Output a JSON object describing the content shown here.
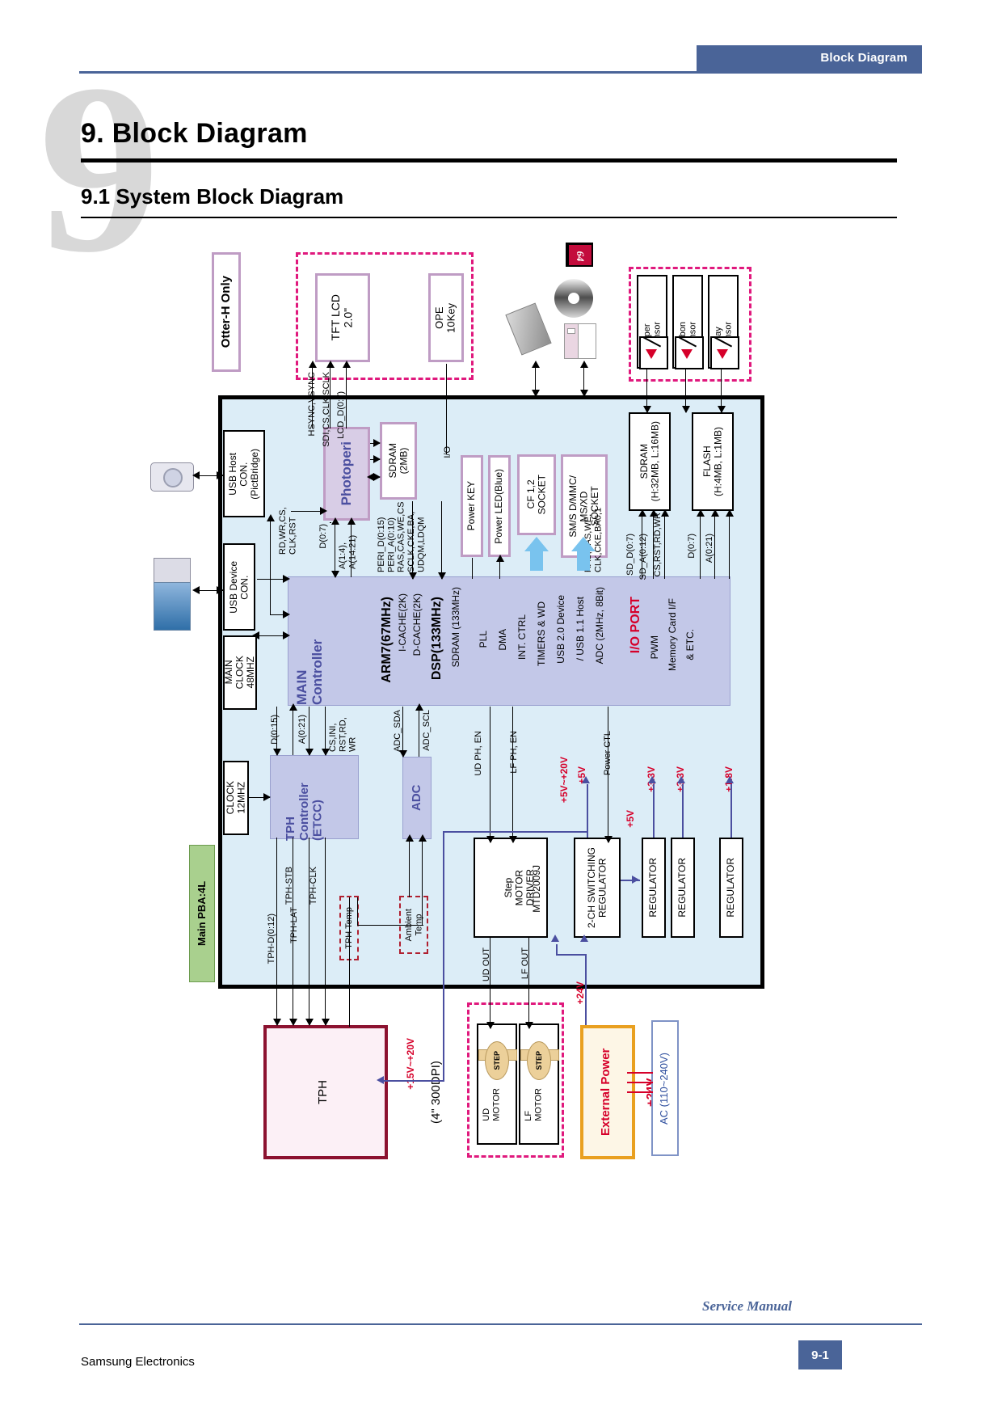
{
  "header": {
    "running_title": "Block Diagram"
  },
  "title": {
    "chapter": "9. Block Diagram",
    "section": "9.1 System Block Diagram",
    "ghost_number": "9"
  },
  "footer": {
    "company": "Samsung Electronics",
    "manual": "Service Manual",
    "page": "9-1"
  },
  "diagram": {
    "otter_note": "Otter-H Only",
    "main_pba": "Main PBA:4L",
    "blocks": {
      "tft_lcd": "TFT LCD\n2.0\"",
      "ope": "OPE\n10Key",
      "usb_host": "USB Host\nCON.\n(PictBridge)",
      "usb_device": "USB Device\nCON.",
      "main_clock": "MAIN\nCLOCK\n48MHZ",
      "clock12": "CLOCK\n12MHZ",
      "photoperi": "Photoperi",
      "sdram2mb": "SDRAM\n(2MB)",
      "power_key": "Power KEY",
      "power_led": "Power LED(Blue)",
      "cf_socket": "CF 1,2\nSOCKET",
      "sm_socket": "SM/S D/MMC/\nMS/XD\nSOCKET",
      "sdram_main": "SDRAM\n(H:32MB, L:16MB)",
      "flash": "FLASH\n(H:4MB, L:1MB)",
      "tph_controller": "TPH\nController\n(ETCC)",
      "adc": "ADC",
      "step_motor_driver": "Step\nMOTOR\nDRIVER",
      "step_motor_part": "MTD2009J",
      "switching_reg": "2-CH SWITCHING\nREGULATOR",
      "regulator": "REGULATOR",
      "tph_head": "TPH\n(4\" 300DPI)",
      "external_power": "External Power\n+24V",
      "ac_input": "AC (110~240V)",
      "ud_motor": "UD\nMOTOR",
      "lf_motor": "LF\nMOTOR",
      "tph_temp": "TPH Temp",
      "ambient_temp": "Ambient\nTemp",
      "cf_card_label": "64"
    },
    "sensors": [
      {
        "name": "Paper\nSensor"
      },
      {
        "name": "Ribbon\nSensor"
      },
      {
        "name": "Tray\nSensor"
      }
    ],
    "main_controller": {
      "title": "MAIN\nController",
      "cpu": "ARM7(67MHz)",
      "cpu_items": [
        "I-CACHE(2K)",
        "D-CACHE(2K)"
      ],
      "dsp": "DSP(133MHz)",
      "dsp_items": [
        "SDRAM (133MHz)",
        "PLL",
        "DMA",
        "INT. CTRL",
        "TIMERS & WD",
        "USB 2.0 Device",
        "/ USB 1.1 Host",
        "ADC (2MHz, 8Bit)"
      ],
      "io_port": "I/O PORT",
      "io_items": [
        "PWM",
        "Memory Card I/F",
        "& ETC."
      ]
    },
    "signals": {
      "hsync": "HSYNC,VSYNC",
      "sdi": "SDI,CS,CLK,SCLK",
      "lcd_d": "LCD_D(0:7)",
      "io": "I/O",
      "rdwr": "RD,WR,CS,\nCLK,RST",
      "d07": "D(0:7)",
      "a14": "A(1:4),\nA(14:21)",
      "peri": "PERI_D(0:15)\nPERI_A(0:10)\nRAS,CAS,WE,CS\nSCLK,CKE,BA,\nUDQM,LDQM",
      "ras": "RAS,CAS,WE,\nCLK,CKE,BA0,1",
      "sd_d": "SD_D(0:7)",
      "sd_a": "SD_A(0:12)",
      "cs_rst": "CS,RST,RD,WR",
      "d07f": "D(0:7)",
      "a021f": "A(0:21)",
      "d015": "D(0:15)",
      "a021": "A(0:21)",
      "cs_ini": "CS,INI,\nRST,RD,\nWR",
      "adc_sda": "ADC_SDA",
      "adc_scl": "ADC_SCL",
      "ud_ph": "UD PH, EN",
      "lf_ph": "LF PH, EN",
      "power_ctl": "Power CTL",
      "ud_out": "UD OUT",
      "lf_out": "LF OUT",
      "tph_d": "TPH-D(0:12)",
      "tph_lat": "TPH-LAT",
      "tph_stb": "TPH-STB",
      "tph_clk": "TPH-CLK"
    },
    "voltages": {
      "v5_20": "+5V~+20V",
      "v5": "+5V",
      "v5b": "+5V",
      "v33a": "+3.3V",
      "v33b": "+3.3V",
      "v18": "+1.8V",
      "v24": "+24V",
      "v15_20": "+15V~+20V"
    }
  }
}
